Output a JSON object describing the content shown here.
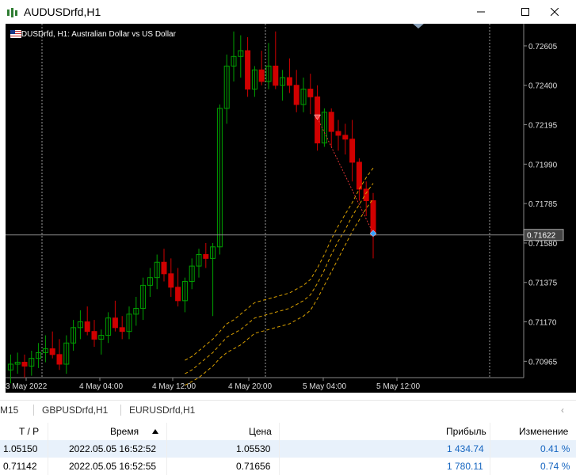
{
  "window": {
    "title": "AUDUSDrfd,H1",
    "minimize_icon": "minimize-icon",
    "maximize_icon": "maximize-icon",
    "close_icon": "close-icon"
  },
  "chart": {
    "symbol_label": "AUDUSDrfd, H1:  Australian Dollar vs US Dollar",
    "current_price": "0.71622",
    "price_axis_labels": [
      "0.72605",
      "0.72400",
      "0.72195",
      "0.71990",
      "0.71785",
      "0.71580",
      "0.71375",
      "0.71170",
      "0.70965"
    ],
    "time_axis_labels": [
      "3 May 2022",
      "4 May 04:00",
      "4 May 12:00",
      "4 May 20:00",
      "5 May 04:00",
      "5 May 12:00"
    ],
    "colors": {
      "background": "#000000",
      "bull": "#00a000",
      "bear": "#d00000",
      "bands": "#d9a000",
      "grid": "#888888"
    }
  },
  "chart_data": {
    "type": "candlestick",
    "title": "AUDUSDrfd, H1",
    "ylim": [
      0.7088,
      0.7272
    ],
    "x": [
      "3 May 2022",
      "4 May 04:00",
      "4 May 12:00",
      "4 May 20:00",
      "5 May 04:00",
      "5 May 12:00"
    ],
    "candles": [
      [
        0.7092,
        0.71,
        0.7085,
        0.7095
      ],
      [
        0.7095,
        0.7101,
        0.709,
        0.7096
      ],
      [
        0.7096,
        0.71,
        0.7088,
        0.7094
      ],
      [
        0.7094,
        0.7102,
        0.7089,
        0.7098
      ],
      [
        0.7098,
        0.7106,
        0.7093,
        0.7101
      ],
      [
        0.7101,
        0.711,
        0.7096,
        0.7103
      ],
      [
        0.7103,
        0.7112,
        0.7098,
        0.71
      ],
      [
        0.71,
        0.7108,
        0.7092,
        0.7095
      ],
      [
        0.7095,
        0.711,
        0.709,
        0.7106
      ],
      [
        0.7106,
        0.7118,
        0.7102,
        0.7114
      ],
      [
        0.7114,
        0.7123,
        0.7108,
        0.7117
      ],
      [
        0.7117,
        0.7125,
        0.711,
        0.7112
      ],
      [
        0.7112,
        0.7118,
        0.7104,
        0.7108
      ],
      [
        0.7108,
        0.7113,
        0.71,
        0.711
      ],
      [
        0.711,
        0.7122,
        0.7106,
        0.7119
      ],
      [
        0.7119,
        0.7128,
        0.7112,
        0.7114
      ],
      [
        0.7114,
        0.712,
        0.7108,
        0.7112
      ],
      [
        0.7112,
        0.7125,
        0.7108,
        0.7121
      ],
      [
        0.7121,
        0.713,
        0.7115,
        0.7124
      ],
      [
        0.7124,
        0.714,
        0.7118,
        0.7136
      ],
      [
        0.7136,
        0.7145,
        0.713,
        0.714
      ],
      [
        0.714,
        0.7152,
        0.7134,
        0.7148
      ],
      [
        0.7148,
        0.7155,
        0.7138,
        0.7142
      ],
      [
        0.7142,
        0.715,
        0.713,
        0.7135
      ],
      [
        0.7135,
        0.7145,
        0.7125,
        0.7128
      ],
      [
        0.7128,
        0.714,
        0.7122,
        0.7138
      ],
      [
        0.7138,
        0.715,
        0.7134,
        0.7146
      ],
      [
        0.7146,
        0.7155,
        0.714,
        0.7152
      ],
      [
        0.7152,
        0.7158,
        0.7145,
        0.715
      ],
      [
        0.715,
        0.7158,
        0.712,
        0.7156
      ],
      [
        0.7156,
        0.723,
        0.7152,
        0.7228
      ],
      [
        0.7228,
        0.7256,
        0.722,
        0.725
      ],
      [
        0.725,
        0.7268,
        0.7242,
        0.7255
      ],
      [
        0.7255,
        0.7266,
        0.7244,
        0.7258
      ],
      [
        0.7258,
        0.7265,
        0.7234,
        0.7238
      ],
      [
        0.7238,
        0.725,
        0.7234,
        0.7248
      ],
      [
        0.7248,
        0.7258,
        0.724,
        0.7242
      ],
      [
        0.7242,
        0.7262,
        0.7238,
        0.725
      ],
      [
        0.725,
        0.7268,
        0.7238,
        0.724
      ],
      [
        0.724,
        0.7248,
        0.7232,
        0.7244
      ],
      [
        0.7244,
        0.7254,
        0.7236,
        0.724
      ],
      [
        0.724,
        0.7248,
        0.7226,
        0.723
      ],
      [
        0.723,
        0.7244,
        0.7226,
        0.7238
      ],
      [
        0.7238,
        0.7246,
        0.7225,
        0.7234
      ],
      [
        0.7234,
        0.724,
        0.7206,
        0.721
      ],
      [
        0.721,
        0.7228,
        0.7208,
        0.7226
      ],
      [
        0.7226,
        0.7228,
        0.7208,
        0.7216
      ],
      [
        0.7216,
        0.7222,
        0.7206,
        0.7214
      ],
      [
        0.7214,
        0.722,
        0.7204,
        0.7212
      ],
      [
        0.7212,
        0.7222,
        0.719,
        0.72
      ],
      [
        0.72,
        0.7202,
        0.718,
        0.7186
      ],
      [
        0.7186,
        0.719,
        0.7172,
        0.718
      ],
      [
        0.718,
        0.7184,
        0.715,
        0.7162
      ]
    ],
    "bands": {
      "upper": [
        0.7097,
        0.7099,
        0.7102,
        0.7105,
        0.7108,
        0.7112,
        0.7116,
        0.7118,
        0.7121,
        0.7124,
        0.7127,
        0.7128,
        0.7129,
        0.713,
        0.7131,
        0.7132,
        0.7134,
        0.7136,
        0.7139,
        0.7145,
        0.7152,
        0.716,
        0.7167,
        0.7173,
        0.7179,
        0.7186,
        0.7192,
        0.7197
      ],
      "middle": [
        0.709,
        0.7092,
        0.7095,
        0.7098,
        0.7101,
        0.7105,
        0.7109,
        0.7111,
        0.7113,
        0.7116,
        0.7119,
        0.712,
        0.7121,
        0.7122,
        0.7123,
        0.7124,
        0.7126,
        0.7128,
        0.7131,
        0.7137,
        0.7144,
        0.7152,
        0.7159,
        0.7165,
        0.7172,
        0.7178,
        0.7184,
        0.7189
      ],
      "lower": [
        0.7084,
        0.7086,
        0.7088,
        0.7091,
        0.7094,
        0.7098,
        0.7101,
        0.7103,
        0.7105,
        0.7108,
        0.7111,
        0.7112,
        0.7113,
        0.7114,
        0.7115,
        0.7116,
        0.7118,
        0.712,
        0.7123,
        0.7129,
        0.7136,
        0.7143,
        0.715,
        0.7157,
        0.7164,
        0.717,
        0.7176,
        0.7181
      ]
    }
  },
  "tabs": [
    "M15",
    "GBPUSDrfd,H1",
    "EURUSDrfd,H1"
  ],
  "table": {
    "headers": {
      "tp": "T / P",
      "time": "Время",
      "price": "Цена",
      "profit": "Прибыль",
      "change": "Изменение"
    },
    "rows": [
      {
        "tp": "1.05150",
        "time": "2022.05.05 16:52:52",
        "price": "1.05530",
        "profit": "1 434.74",
        "change": "0.41 %"
      },
      {
        "tp": "0.71142",
        "time": "2022.05.05 16:52:55",
        "price": "0.71656",
        "profit": "1 780.11",
        "change": "0.74 %"
      }
    ]
  }
}
